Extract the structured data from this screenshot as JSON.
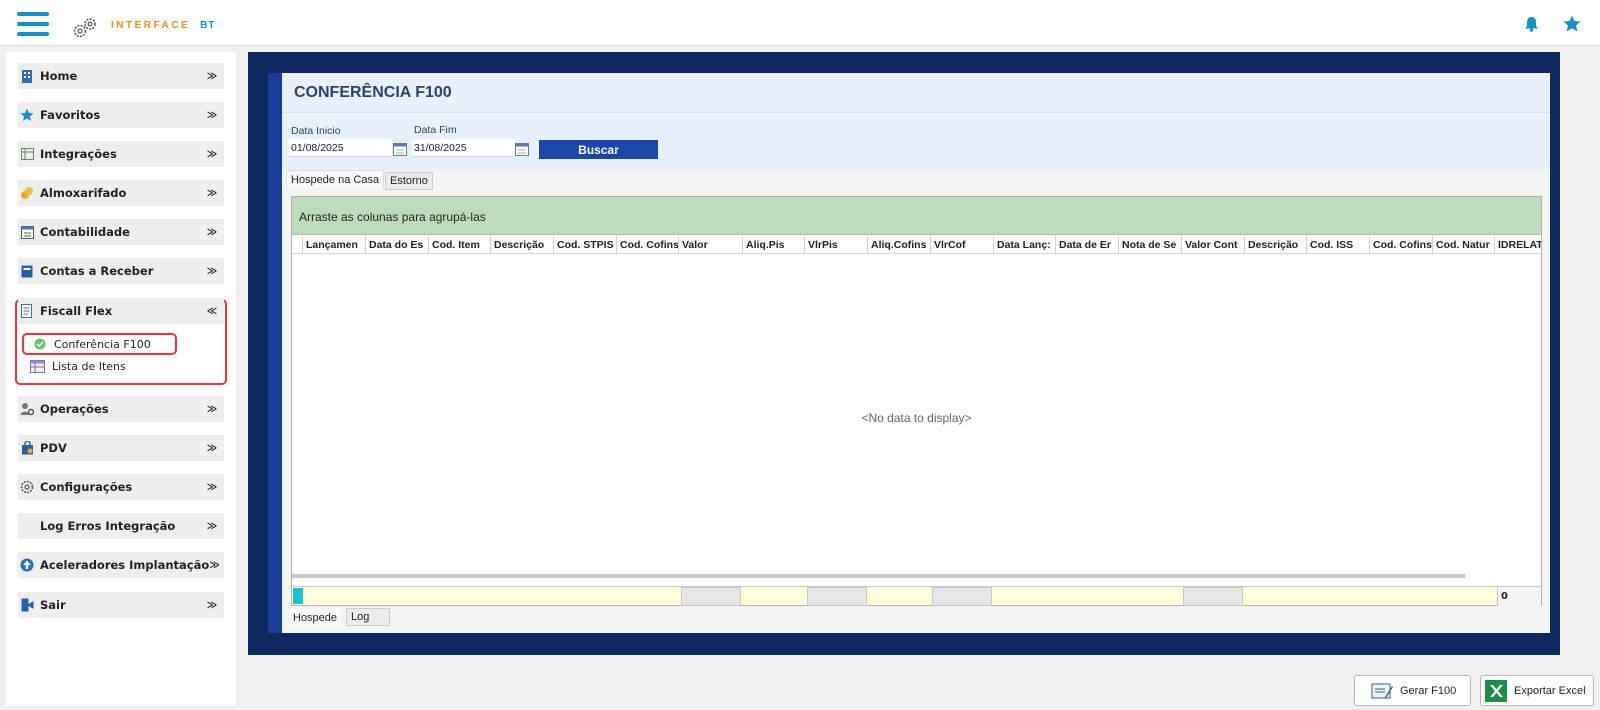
{
  "app": {
    "logo_text": "INTERFACE",
    "logo_suffix": "BT"
  },
  "sidebar": {
    "items": [
      {
        "label": "Home",
        "icon": "building-icon"
      },
      {
        "label": "Favoritos",
        "icon": "star-icon"
      },
      {
        "label": "Integrações",
        "icon": "table-icon"
      },
      {
        "label": "Almoxarifado",
        "icon": "coins-icon"
      },
      {
        "label": "Contabilidade",
        "icon": "ledger-icon"
      },
      {
        "label": "Contas a Receber",
        "icon": "card-icon"
      },
      {
        "label": "Fiscall Flex",
        "icon": "document-icon"
      },
      {
        "label": "Operações",
        "icon": "user-gear-icon"
      },
      {
        "label": "PDV",
        "icon": "bag-icon"
      },
      {
        "label": "Configurações",
        "icon": "gear-icon"
      },
      {
        "label": "Log Erros Integração",
        "icon": "log-icon"
      },
      {
        "label": "Aceleradores Implantação",
        "icon": "arrow-up-circle-icon"
      },
      {
        "label": "Sair",
        "icon": "exit-icon"
      }
    ],
    "fiscal_sub": [
      {
        "label": "Conferência F100",
        "icon": "check-circle-icon"
      },
      {
        "label": "Lista de Itens",
        "icon": "list-icon"
      }
    ]
  },
  "page": {
    "title": "CONFERÊNCIA F100",
    "date_start_label": "Data Inicio",
    "date_start_value": "01/08/2025",
    "date_end_label": "Data Fim",
    "date_end_value": "31/08/2025",
    "search_label": "Buscar",
    "tabs": [
      "Hospede na Casa",
      "Estorno"
    ],
    "group_hint": "Arraste as colunas para agrupá-las",
    "columns": [
      "Lançamen",
      "Data do Es",
      "Cod. Item",
      "Descrição",
      "Cod. STPIS",
      "Cod. Cofins",
      "Valor",
      "Aliq.Pis",
      "VlrPis",
      "Aliq.Cofins",
      "VlrCof",
      "Data Lanç:",
      "Data de Er",
      "Nota de Se",
      "Valor Cont",
      "Descrição",
      "Cod. ISS",
      "Cod. Cofins",
      "Cod. Natur",
      "IDRELAT"
    ],
    "no_data": "<No data to display>",
    "footer_count": "0",
    "bottom_tabs": [
      "Hospede",
      "Log"
    ]
  },
  "actions": {
    "gerar": "Gerar F100",
    "exportar": "Exportar Excel"
  },
  "colors": {
    "accent": "#1492c8",
    "brand_orange": "#f08a24",
    "navy": "#0e2a5e",
    "button_blue": "#1a47a8",
    "group_green": "#bedbbd",
    "highlight_red": "#e8343c"
  }
}
